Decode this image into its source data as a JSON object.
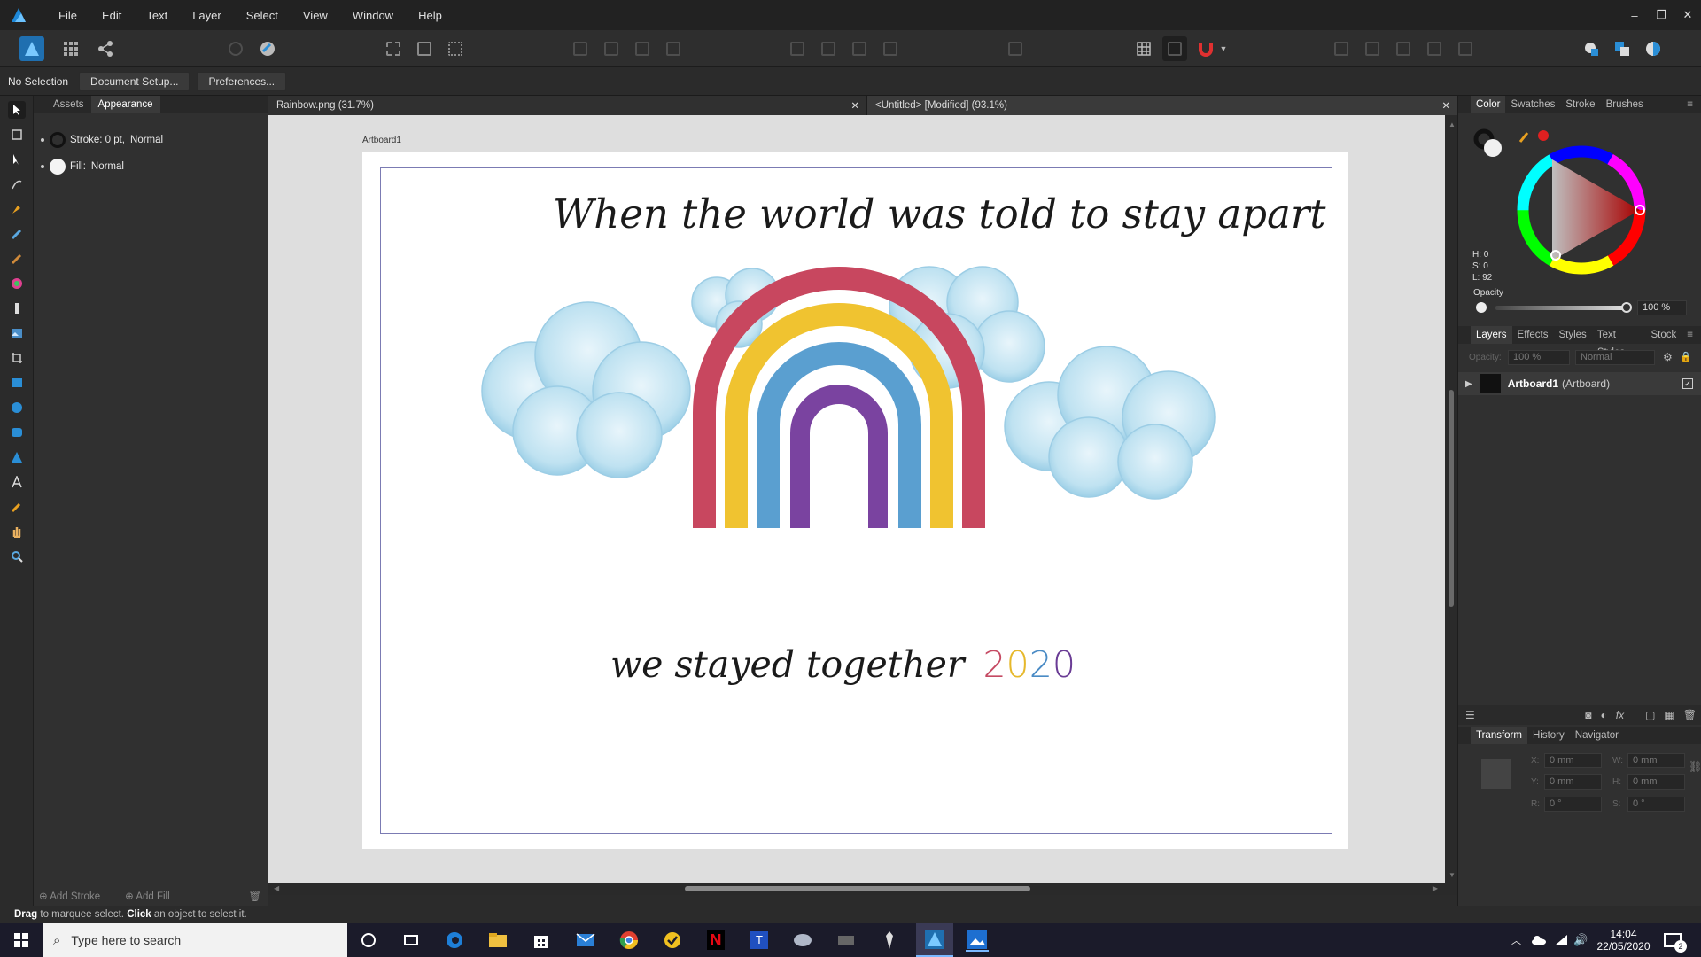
{
  "app": {
    "menu": [
      "File",
      "Edit",
      "Text",
      "Layer",
      "Select",
      "View",
      "Window",
      "Help"
    ],
    "window_controls": [
      "–",
      "❐",
      "✕"
    ]
  },
  "context": {
    "selection": "No Selection",
    "document_setup": "Document Setup...",
    "preferences": "Preferences..."
  },
  "left_panel": {
    "tabs": [
      "Assets",
      "Appearance"
    ],
    "stroke_label": "Stroke: 0 pt,",
    "stroke_blend": "Normal",
    "fill_label": "Fill:",
    "fill_blend": "Normal",
    "add_stroke": "Add Stroke",
    "add_fill": "Add Fill"
  },
  "documents": {
    "tabs": [
      "Rainbow.png (31.7%)",
      "<Untitled> [Modified] (93.1%)"
    ],
    "close_glyph": "✕"
  },
  "artboard": {
    "label": "Artboard1",
    "headline": "When the world was told to stay apart",
    "footer_text": "we stayed together",
    "year_digits": [
      {
        "d": "2",
        "color": "#c54a63"
      },
      {
        "d": "0",
        "color": "#e6b82b"
      },
      {
        "d": "2",
        "color": "#4a8bc5"
      },
      {
        "d": "0",
        "color": "#6a3c95"
      }
    ],
    "rainbow_colors": [
      "#c8475f",
      "#f0c330",
      "#5a9fd0",
      "#7a43a0"
    ]
  },
  "right_panel": {
    "color_tabs": [
      "Color",
      "Swatches",
      "Stroke",
      "Brushes"
    ],
    "hsl": {
      "h": "H: 0",
      "s": "S: 0",
      "l": "L: 92"
    },
    "opacity_label": "Opacity",
    "opacity_value": "100 %",
    "layer_tabs": [
      "Layers",
      "Effects",
      "Styles",
      "Text Styles",
      "Stock"
    ],
    "layer_opacity_label": "Opacity:",
    "layer_opacity": "100 %",
    "layer_blend": "Normal",
    "layer_name": "Artboard1",
    "layer_type": "(Artboard)",
    "transform_tabs": [
      "Transform",
      "History",
      "Navigator"
    ],
    "transform": {
      "x_label": "X:",
      "x": "0 mm",
      "w_label": "W:",
      "w": "0 mm",
      "y_label": "Y:",
      "y": "0 mm",
      "h_label": "H:",
      "h": "0 mm",
      "r_label": "R:",
      "r": "0 °",
      "s_label": "S:",
      "s": "0 °"
    }
  },
  "status": {
    "drag": "Drag",
    "drag_rest": " to marquee select. ",
    "click": "Click",
    "click_rest": " an object to select it."
  },
  "taskbar": {
    "search_placeholder": "Type here to search",
    "time": "14:04",
    "date": "22/05/2020",
    "notifications": "2"
  },
  "colors": {
    "accent": "#2a8ed6",
    "app_bg": "#2b2b2b",
    "artboard_frame": "#7b7bb3"
  }
}
